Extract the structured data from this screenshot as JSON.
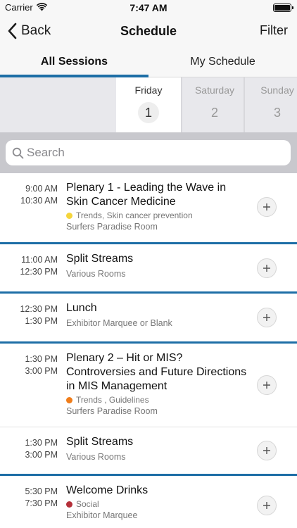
{
  "status_bar": {
    "carrier": "Carrier",
    "time": "7:47 AM"
  },
  "nav": {
    "back_label": "Back",
    "title": "Schedule",
    "filter_label": "Filter"
  },
  "tabs": [
    {
      "label": "All Sessions",
      "selected": true
    },
    {
      "label": "My Schedule",
      "selected": false
    }
  ],
  "days": [
    {
      "name": "Friday",
      "number": "1",
      "selected": true
    },
    {
      "name": "Saturday",
      "number": "2",
      "selected": false
    },
    {
      "name": "Sunday",
      "number": "3",
      "selected": false
    }
  ],
  "search": {
    "placeholder": "Search",
    "value": ""
  },
  "colors": {
    "accent": "#1d6ea6",
    "tag_trends_skin": "#f5d53c",
    "tag_trends_guidelines": "#f07d1a",
    "tag_social": "#b5303a"
  },
  "sessions": [
    {
      "start": "9:00 AM",
      "end": "10:30 AM",
      "title": "Plenary 1 - Leading the Wave in Skin Cancer Medicine",
      "tags": "Trends, Skin cancer prevention",
      "room": "Surfers Paradise Room"
    },
    {
      "start": "11:00 AM",
      "end": "12:30 PM",
      "title": "Split Streams",
      "room": "Various Rooms"
    },
    {
      "start": "12:30 PM",
      "end": "1:30 PM",
      "title": "Lunch",
      "room": "Exhibitor Marquee or Blank"
    },
    {
      "start": "1:30 PM",
      "end": "3:00 PM",
      "title": "Plenary 2 – Hit or MIS? Controversies and Future Directions in MIS Management",
      "tags": "Trends , Guidelines",
      "room": "Surfers Paradise Room"
    },
    {
      "start": "1:30 PM",
      "end": "3:00 PM",
      "title": "Split Streams",
      "room": "Various Rooms"
    },
    {
      "start": "5:30 PM",
      "end": "7:30 PM",
      "title": "Welcome Drinks",
      "tags": "Social",
      "room": "Exhibitor Marquee"
    }
  ]
}
